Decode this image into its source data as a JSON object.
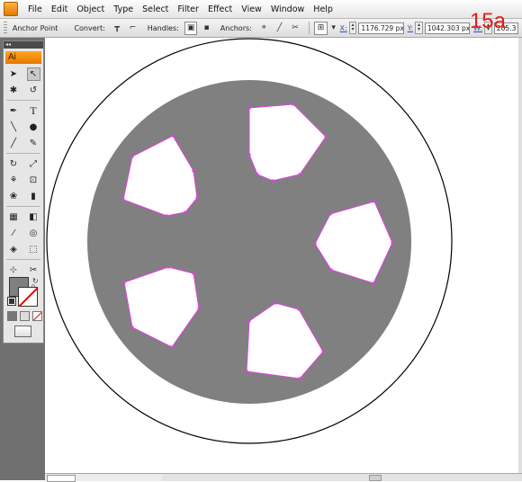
{
  "menubar": {
    "items": [
      "File",
      "Edit",
      "Object",
      "Type",
      "Select",
      "Filter",
      "Effect",
      "View",
      "Window",
      "Help"
    ],
    "annotation": "15a"
  },
  "controlbar": {
    "tool_name": "Anchor Point",
    "convert_label": "Convert:",
    "handles_label": "Handles:",
    "anchors_label": "Anchors:",
    "x_label": "X:",
    "x_value": "1176.729 px",
    "y_label": "Y:",
    "y_value": "1042.303 px",
    "w_label": "W:",
    "w_value": "265.3"
  },
  "toolbox": {
    "logo": "Ai",
    "title": "◂◂"
  },
  "icons": {
    "selection": "selection-arrow-icon",
    "direct_selection": "direct-selection-icon",
    "magic_wand": "magic-wand-icon",
    "lasso": "lasso-icon",
    "pen": "pen-icon",
    "type": "type-icon",
    "line": "line-segment-icon",
    "ellipse": "ellipse-icon",
    "paintbrush": "paintbrush-icon",
    "pencil": "pencil-icon",
    "rotate": "rotate-icon",
    "scale": "scale-icon",
    "warp": "warp-icon",
    "free_transform": "free-transform-icon",
    "symbol_sprayer": "symbol-sprayer-icon",
    "graph": "column-graph-icon",
    "mesh": "mesh-icon",
    "gradient": "gradient-icon",
    "eyedropper": "eyedropper-icon",
    "blend": "blend-icon",
    "live_paint": "live-paint-bucket-icon",
    "live_paint_select": "live-paint-selection-icon",
    "slice": "slice-icon",
    "scissors": "scissors-icon",
    "hand": "hand-icon",
    "zoom": "zoom-icon"
  },
  "colors": {
    "fill": "#808080",
    "stroke": "none",
    "path_highlight": "#e040e0",
    "annotation": "#e41b17",
    "logo": "#f08a00"
  }
}
